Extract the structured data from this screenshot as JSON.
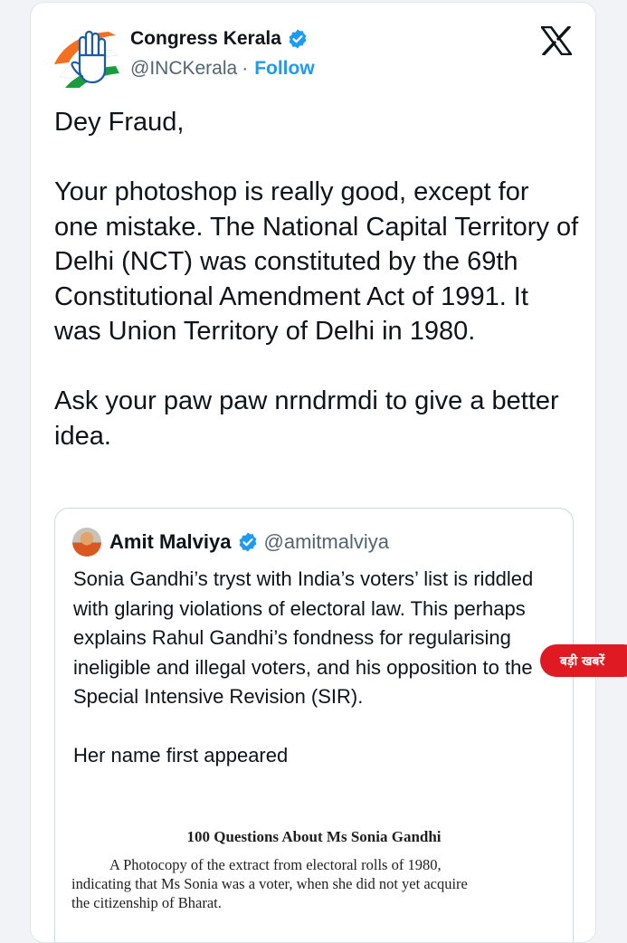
{
  "tweet": {
    "author_name": "Congress Kerala",
    "author_handle": "@INCKerala",
    "separator": "·",
    "follow_label": "Follow",
    "text": "Dey Fraud,\n\nYour photoshop is really good, except for one mistake. The National Capital Territory of Delhi (NCT) was constituted by the 69th Constitutional Amendment Act of 1991. It was Union Territory of Delhi in 1980.\n\nAsk your paw paw nrndrmdi to give a better idea.",
    "icons": {
      "verified": "verified-badge-icon",
      "platform": "x-logo-icon",
      "avatar": "congress-hand-logo"
    }
  },
  "quote": {
    "author_name": "Amit Malviya",
    "author_handle": "@amitmalviya",
    "text": "Sonia Gandhi’s tryst with India’s voters’ list is riddled with glaring violations of electoral law. This perhaps explains Rahul Gandhi’s fondness for regularising ineligible and illegal voters, and his opposition to the Special Intensive Revision (SIR).\n\nHer name first appeared",
    "document": {
      "title": "100 Questions About Ms Sonia Gandhi",
      "line1": "A Photocopy of the extract from electoral rolls of 1980,",
      "line2": "indicating that Ms Sonia was a voter, when she did not yet acquire",
      "line3": "the citizenship of Bharat."
    }
  },
  "overlay_badge": {
    "label": "बड़ी खबरें"
  },
  "colors": {
    "accent": "#1d9bf0",
    "verified": "#1d9bf0",
    "badge": "#e01a22",
    "text": "#0f1419",
    "muted": "#536471"
  }
}
